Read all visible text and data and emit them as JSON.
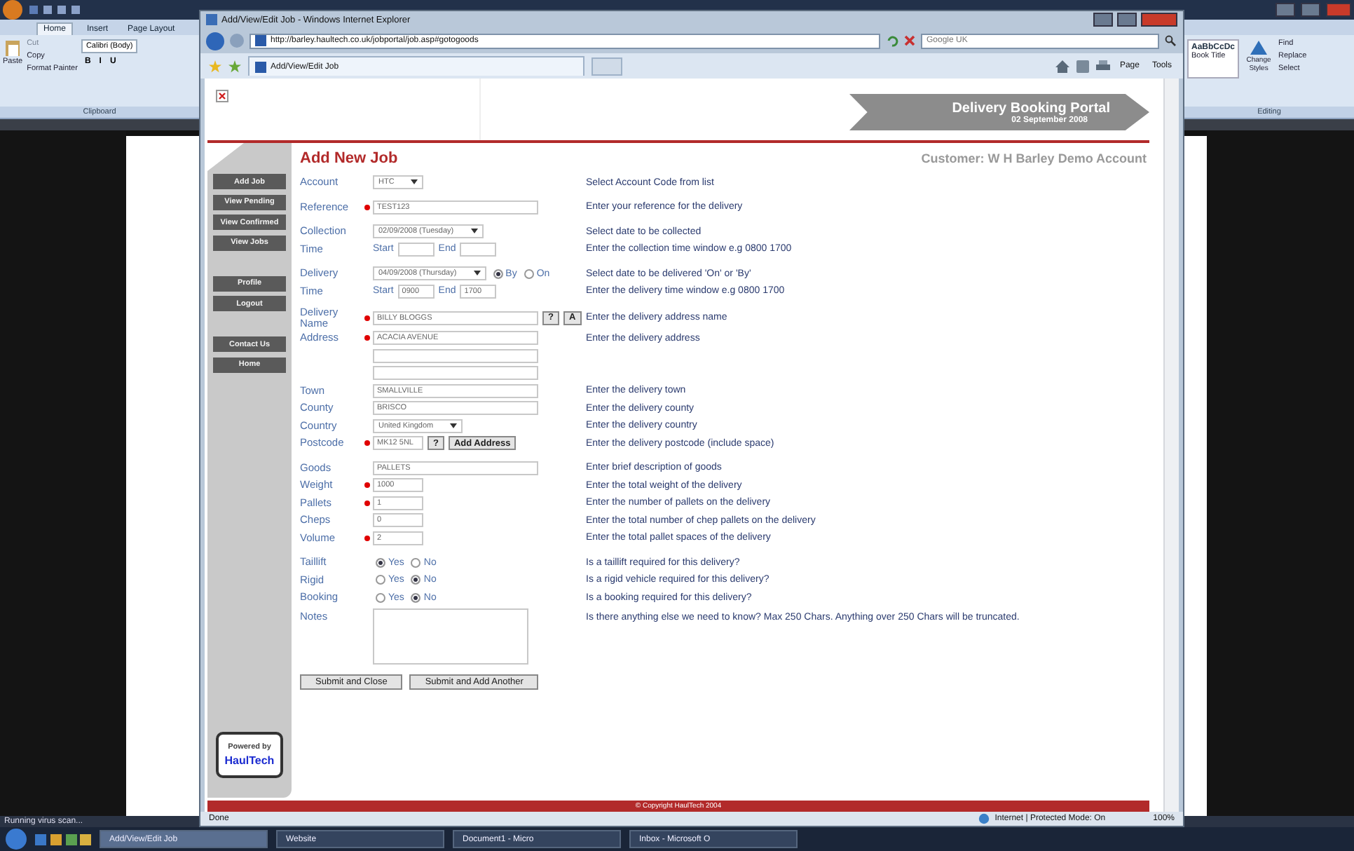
{
  "word": {
    "tabs": [
      {
        "label": "Home",
        "selected": true
      },
      {
        "label": "Insert",
        "selected": false
      },
      {
        "label": "Page Layout",
        "selected": false
      }
    ],
    "clipboard": {
      "paste": "Paste",
      "items": [
        "Cut",
        "Copy",
        "Format Painter"
      ],
      "group": "Clipboard"
    },
    "font": {
      "name": "Calibri (Body)",
      "buttons": [
        "B",
        "I",
        "U"
      ]
    },
    "styles": {
      "preview": "AaBbCcDc",
      "name": "Book Title",
      "change": "Change Styles"
    },
    "editing": {
      "items": [
        "Find",
        "Replace",
        "Select"
      ],
      "group": "Editing"
    },
    "status": "Running virus scan..."
  },
  "taskbar": {
    "items": [
      {
        "label": "Add/View/Edit Job",
        "selected": true
      },
      {
        "label": "Website",
        "selected": false
      },
      {
        "label": "Document1 - Micro",
        "selected": false
      },
      {
        "label": "Inbox - Microsoft O",
        "selected": false
      }
    ]
  },
  "browser": {
    "title": "Add/View/Edit Job - Windows Internet Explorer",
    "url": "http://barley.haultech.co.uk/jobportal/job.asp#gotogoods",
    "search": {
      "placeholder": "Google UK"
    },
    "tab": "Add/View/Edit Job",
    "tools": [
      "Page",
      "Tools"
    ],
    "status": "Done",
    "zone": "Internet | Protected Mode: On",
    "zoom": "100%"
  },
  "page": {
    "portal": {
      "title": "Delivery Booking Portal",
      "date": "02 September 2008"
    },
    "nav": [
      [
        "Add Job",
        "View Pending",
        "View Confirmed",
        "View Jobs"
      ],
      [
        "Profile",
        "Logout"
      ],
      [
        "Contact Us",
        "Home"
      ]
    ],
    "powered": {
      "caption": "Powered by",
      "brand": "HaulTech"
    },
    "heading": "Add New Job",
    "customer": "Customer: W H Barley Demo Account",
    "groups": [
      [
        {
          "kind": "select",
          "label": "Account",
          "required": false,
          "value": "HTC",
          "help": "Select Account Code from list"
        }
      ],
      [
        {
          "kind": "text",
          "label": "Reference",
          "required": true,
          "value": "TEST123",
          "help": "Enter your reference for the delivery"
        }
      ],
      [
        {
          "kind": "select",
          "label": "Collection",
          "required": false,
          "value": "02/09/2008 (Tuesday)",
          "help": "Select date to be collected"
        },
        {
          "kind": "time",
          "label": "Time",
          "required": false,
          "start_label": "Start",
          "end_label": "End",
          "help": "Enter the collection time window e.g 0800 1700"
        }
      ],
      [
        {
          "kind": "select",
          "label": "Delivery",
          "required": false,
          "value": "04/09/2008 (Thursday)",
          "options": [
            {
              "label": "By",
              "selected": true
            },
            {
              "label": "On",
              "selected": false
            }
          ],
          "help": "Select date to be delivered 'On' or 'By'"
        },
        {
          "kind": "time",
          "label": "Time",
          "required": false,
          "start_label": "Start",
          "start": "0900",
          "end_label": "End",
          "end": "1700",
          "help": "Enter the delivery time window e.g 0800 1700"
        }
      ],
      [
        {
          "kind": "text",
          "label": "Delivery Name",
          "required": true,
          "value": "BILLY BLOGGS",
          "buttons": [
            "?",
            "A"
          ],
          "help": "Enter the delivery address name"
        },
        {
          "kind": "text",
          "label": "Address",
          "required": true,
          "value": "ACACIA AVENUE",
          "help": "Enter the delivery address"
        },
        {
          "kind": "line",
          "required": false
        },
        {
          "kind": "line",
          "required": false
        },
        {
          "kind": "text",
          "label": "Town",
          "required": false,
          "value": "SMALLVILLE",
          "help": "Enter the delivery town"
        },
        {
          "kind": "text",
          "label": "County",
          "required": false,
          "value": "BRISCO",
          "help": "Enter the delivery county"
        },
        {
          "kind": "select",
          "label": "Country",
          "required": false,
          "value": "United Kingdom",
          "help": "Enter the delivery country"
        },
        {
          "kind": "number",
          "label": "Postcode",
          "required": true,
          "value": "MK12 5NL",
          "buttons": [
            "?",
            "Add Address"
          ],
          "help": "Enter the delivery postcode (include space)"
        }
      ],
      [
        {
          "kind": "text",
          "label": "Goods",
          "required": false,
          "value": "PALLETS",
          "help": "Enter brief description of goods"
        },
        {
          "kind": "number",
          "label": "Weight",
          "required": true,
          "value": "1000",
          "help": "Enter the total weight of the delivery"
        },
        {
          "kind": "number",
          "label": "Pallets",
          "required": true,
          "value": "1",
          "help": "Enter the number of pallets on the delivery"
        },
        {
          "kind": "number",
          "label": "Cheps",
          "required": false,
          "value": "0",
          "help": "Enter the total number of chep pallets on the delivery"
        },
        {
          "kind": "number",
          "label": "Volume",
          "required": true,
          "value": "2",
          "help": "Enter the total pallet spaces of the delivery"
        }
      ],
      [
        {
          "kind": "radio",
          "label": "Taillift",
          "required": false,
          "options": [
            {
              "label": "Yes",
              "selected": true
            },
            {
              "label": "No",
              "selected": false
            }
          ],
          "help": "Is a taillift required for this delivery?"
        },
        {
          "kind": "radio",
          "label": "Rigid",
          "required": false,
          "options": [
            {
              "label": "Yes",
              "selected": false
            },
            {
              "label": "No",
              "selected": true
            }
          ],
          "help": "Is a rigid vehicle required for this delivery?"
        },
        {
          "kind": "radio",
          "label": "Booking",
          "required": false,
          "options": [
            {
              "label": "Yes",
              "selected": false
            },
            {
              "label": "No",
              "selected": true
            }
          ],
          "help": "Is a booking required for this delivery?"
        },
        {
          "kind": "textarea",
          "label": "Notes",
          "required": false,
          "help": "Is there anything else we need to know? Max 250 Chars. Anything over 250 Chars will be truncated."
        }
      ]
    ],
    "buttons": [
      "Submit and Close",
      "Submit and Add Another"
    ],
    "footer": "© Copyright  HaulTech 2004"
  }
}
